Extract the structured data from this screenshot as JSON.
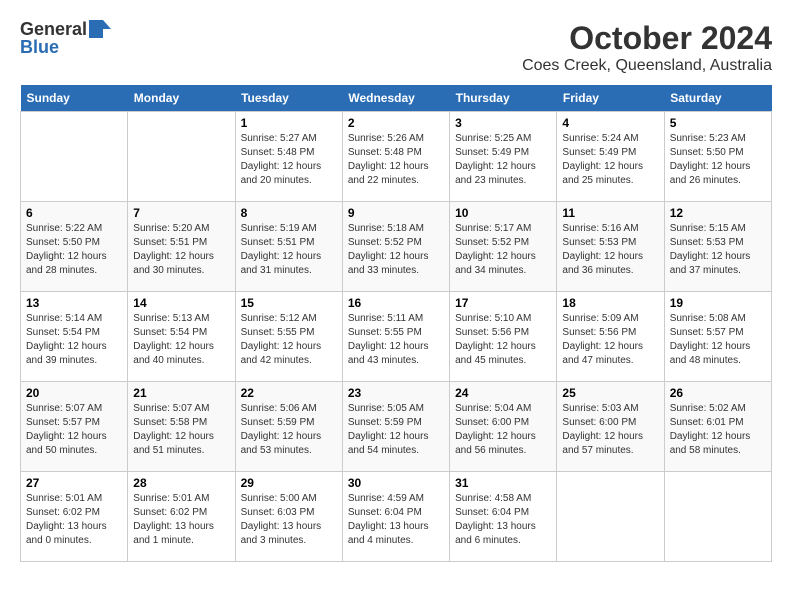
{
  "logo": {
    "general": "General",
    "blue": "Blue"
  },
  "title": "October 2024",
  "location": "Coes Creek, Queensland, Australia",
  "days_of_week": [
    "Sunday",
    "Monday",
    "Tuesday",
    "Wednesday",
    "Thursday",
    "Friday",
    "Saturday"
  ],
  "weeks": [
    [
      {
        "day": "",
        "info": ""
      },
      {
        "day": "",
        "info": ""
      },
      {
        "day": "1",
        "info": "Sunrise: 5:27 AM\nSunset: 5:48 PM\nDaylight: 12 hours and 20 minutes."
      },
      {
        "day": "2",
        "info": "Sunrise: 5:26 AM\nSunset: 5:48 PM\nDaylight: 12 hours and 22 minutes."
      },
      {
        "day": "3",
        "info": "Sunrise: 5:25 AM\nSunset: 5:49 PM\nDaylight: 12 hours and 23 minutes."
      },
      {
        "day": "4",
        "info": "Sunrise: 5:24 AM\nSunset: 5:49 PM\nDaylight: 12 hours and 25 minutes."
      },
      {
        "day": "5",
        "info": "Sunrise: 5:23 AM\nSunset: 5:50 PM\nDaylight: 12 hours and 26 minutes."
      }
    ],
    [
      {
        "day": "6",
        "info": "Sunrise: 5:22 AM\nSunset: 5:50 PM\nDaylight: 12 hours and 28 minutes."
      },
      {
        "day": "7",
        "info": "Sunrise: 5:20 AM\nSunset: 5:51 PM\nDaylight: 12 hours and 30 minutes."
      },
      {
        "day": "8",
        "info": "Sunrise: 5:19 AM\nSunset: 5:51 PM\nDaylight: 12 hours and 31 minutes."
      },
      {
        "day": "9",
        "info": "Sunrise: 5:18 AM\nSunset: 5:52 PM\nDaylight: 12 hours and 33 minutes."
      },
      {
        "day": "10",
        "info": "Sunrise: 5:17 AM\nSunset: 5:52 PM\nDaylight: 12 hours and 34 minutes."
      },
      {
        "day": "11",
        "info": "Sunrise: 5:16 AM\nSunset: 5:53 PM\nDaylight: 12 hours and 36 minutes."
      },
      {
        "day": "12",
        "info": "Sunrise: 5:15 AM\nSunset: 5:53 PM\nDaylight: 12 hours and 37 minutes."
      }
    ],
    [
      {
        "day": "13",
        "info": "Sunrise: 5:14 AM\nSunset: 5:54 PM\nDaylight: 12 hours and 39 minutes."
      },
      {
        "day": "14",
        "info": "Sunrise: 5:13 AM\nSunset: 5:54 PM\nDaylight: 12 hours and 40 minutes."
      },
      {
        "day": "15",
        "info": "Sunrise: 5:12 AM\nSunset: 5:55 PM\nDaylight: 12 hours and 42 minutes."
      },
      {
        "day": "16",
        "info": "Sunrise: 5:11 AM\nSunset: 5:55 PM\nDaylight: 12 hours and 43 minutes."
      },
      {
        "day": "17",
        "info": "Sunrise: 5:10 AM\nSunset: 5:56 PM\nDaylight: 12 hours and 45 minutes."
      },
      {
        "day": "18",
        "info": "Sunrise: 5:09 AM\nSunset: 5:56 PM\nDaylight: 12 hours and 47 minutes."
      },
      {
        "day": "19",
        "info": "Sunrise: 5:08 AM\nSunset: 5:57 PM\nDaylight: 12 hours and 48 minutes."
      }
    ],
    [
      {
        "day": "20",
        "info": "Sunrise: 5:07 AM\nSunset: 5:57 PM\nDaylight: 12 hours and 50 minutes."
      },
      {
        "day": "21",
        "info": "Sunrise: 5:07 AM\nSunset: 5:58 PM\nDaylight: 12 hours and 51 minutes."
      },
      {
        "day": "22",
        "info": "Sunrise: 5:06 AM\nSunset: 5:59 PM\nDaylight: 12 hours and 53 minutes."
      },
      {
        "day": "23",
        "info": "Sunrise: 5:05 AM\nSunset: 5:59 PM\nDaylight: 12 hours and 54 minutes."
      },
      {
        "day": "24",
        "info": "Sunrise: 5:04 AM\nSunset: 6:00 PM\nDaylight: 12 hours and 56 minutes."
      },
      {
        "day": "25",
        "info": "Sunrise: 5:03 AM\nSunset: 6:00 PM\nDaylight: 12 hours and 57 minutes."
      },
      {
        "day": "26",
        "info": "Sunrise: 5:02 AM\nSunset: 6:01 PM\nDaylight: 12 hours and 58 minutes."
      }
    ],
    [
      {
        "day": "27",
        "info": "Sunrise: 5:01 AM\nSunset: 6:02 PM\nDaylight: 13 hours and 0 minutes."
      },
      {
        "day": "28",
        "info": "Sunrise: 5:01 AM\nSunset: 6:02 PM\nDaylight: 13 hours and 1 minute."
      },
      {
        "day": "29",
        "info": "Sunrise: 5:00 AM\nSunset: 6:03 PM\nDaylight: 13 hours and 3 minutes."
      },
      {
        "day": "30",
        "info": "Sunrise: 4:59 AM\nSunset: 6:04 PM\nDaylight: 13 hours and 4 minutes."
      },
      {
        "day": "31",
        "info": "Sunrise: 4:58 AM\nSunset: 6:04 PM\nDaylight: 13 hours and 6 minutes."
      },
      {
        "day": "",
        "info": ""
      },
      {
        "day": "",
        "info": ""
      }
    ]
  ]
}
